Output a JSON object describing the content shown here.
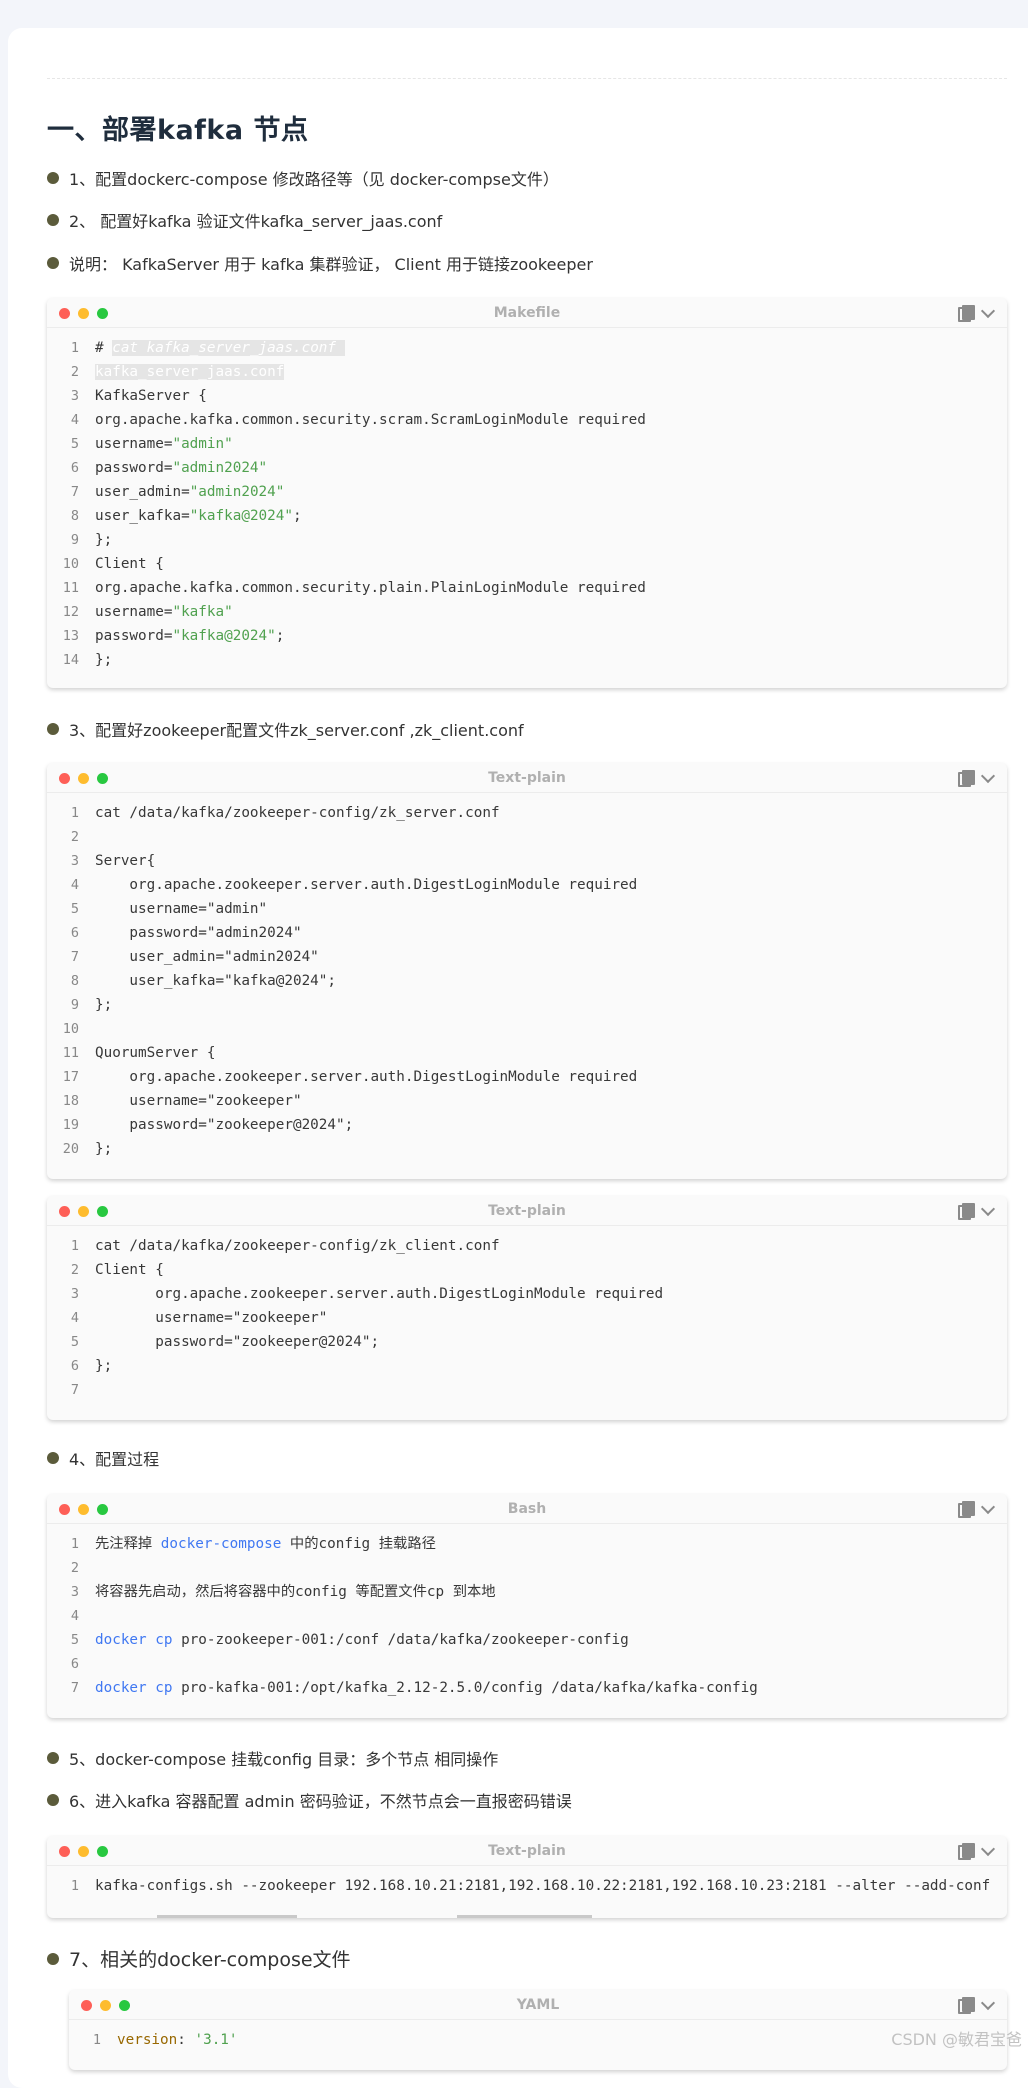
{
  "heading": "一、部署kafka 节点",
  "bullets": [
    "1、配置dockerc-compose 修改路径等（见 docker-compse文件）",
    "2、 配置好kafka 验证文件kafka_server_jaas.conf",
    "说明： KafkaServer 用于 kafka 集群验证， Client 用于链接zookeeper",
    "3、配置好zookeeper配置文件zk_server.conf ,zk_client.conf",
    "4、配置过程",
    "5、docker-compose 挂载config 目录：多个节点 相同操作",
    "6、进入kafka 容器配置 admin 密码验证，不然节点会一直报密码错误",
    "7、相关的docker-compose文件"
  ],
  "code_blocks": [
    {
      "lang": "Makefile",
      "lines": [
        {
          "n": "1",
          "parts": [
            {
              "t": "# ",
              "c": "plain"
            },
            {
              "t": "cat kafka_server_jaas.conf ",
              "c": "hl"
            }
          ]
        },
        {
          "n": "2",
          "parts": [
            {
              "t": "kafka_server_jaas.conf",
              "c": "hlc"
            }
          ]
        },
        {
          "n": "3",
          "parts": [
            {
              "t": "KafkaServer {",
              "c": "plain"
            }
          ]
        },
        {
          "n": "4",
          "parts": [
            {
              "t": "org.apache.kafka.common.security.scram.ScramLoginModule required",
              "c": "plain"
            }
          ]
        },
        {
          "n": "5",
          "parts": [
            {
              "t": "username=",
              "c": "plain"
            },
            {
              "t": "\"admin\"",
              "c": "str"
            }
          ]
        },
        {
          "n": "6",
          "parts": [
            {
              "t": "password=",
              "c": "plain"
            },
            {
              "t": "\"admin2024\"",
              "c": "str"
            }
          ]
        },
        {
          "n": "7",
          "parts": [
            {
              "t": "user_admin=",
              "c": "plain"
            },
            {
              "t": "\"admin2024\"",
              "c": "str"
            }
          ]
        },
        {
          "n": "8",
          "parts": [
            {
              "t": "user_kafka=",
              "c": "plain"
            },
            {
              "t": "\"kafka@2024\"",
              "c": "str"
            },
            {
              "t": ";",
              "c": "plain"
            }
          ]
        },
        {
          "n": "9",
          "parts": [
            {
              "t": "};",
              "c": "plain"
            }
          ]
        },
        {
          "n": "10",
          "parts": [
            {
              "t": "Client {",
              "c": "plain"
            }
          ]
        },
        {
          "n": "11",
          "parts": [
            {
              "t": "org.apache.kafka.common.security.plain.PlainLoginModule required",
              "c": "plain"
            }
          ]
        },
        {
          "n": "12",
          "parts": [
            {
              "t": "username=",
              "c": "plain"
            },
            {
              "t": "\"kafka\"",
              "c": "str"
            }
          ]
        },
        {
          "n": "13",
          "parts": [
            {
              "t": "password=",
              "c": "plain"
            },
            {
              "t": "\"kafka@2024\"",
              "c": "str"
            },
            {
              "t": ";",
              "c": "plain"
            }
          ]
        },
        {
          "n": "14",
          "parts": [
            {
              "t": "};",
              "c": "plain"
            }
          ]
        }
      ]
    },
    {
      "lang": "Text-plain",
      "lines": [
        {
          "n": "1",
          "parts": [
            {
              "t": "cat /data/kafka/zookeeper-config/zk_server.conf",
              "c": "plain"
            }
          ]
        },
        {
          "n": "2",
          "parts": [
            {
              "t": "",
              "c": "plain"
            }
          ]
        },
        {
          "n": "3",
          "parts": [
            {
              "t": "Server{",
              "c": "plain"
            }
          ]
        },
        {
          "n": "4",
          "parts": [
            {
              "t": "    org.apache.zookeeper.server.auth.DigestLoginModule required",
              "c": "plain"
            }
          ]
        },
        {
          "n": "5",
          "parts": [
            {
              "t": "    username=\"admin\"",
              "c": "plain"
            }
          ]
        },
        {
          "n": "6",
          "parts": [
            {
              "t": "    password=\"admin2024\"",
              "c": "plain"
            }
          ]
        },
        {
          "n": "7",
          "parts": [
            {
              "t": "    user_admin=\"admin2024\"",
              "c": "plain"
            }
          ]
        },
        {
          "n": "8",
          "parts": [
            {
              "t": "    user_kafka=\"kafka@2024\";",
              "c": "plain"
            }
          ]
        },
        {
          "n": "9",
          "parts": [
            {
              "t": "};",
              "c": "plain"
            }
          ]
        },
        {
          "n": "10",
          "parts": [
            {
              "t": "",
              "c": "plain"
            }
          ]
        },
        {
          "n": "11",
          "parts": [
            {
              "t": "QuorumServer {",
              "c": "plain"
            }
          ]
        },
        {
          "n": "17",
          "parts": [
            {
              "t": "    org.apache.zookeeper.server.auth.DigestLoginModule required",
              "c": "plain"
            }
          ]
        },
        {
          "n": "18",
          "parts": [
            {
              "t": "    username=\"zookeeper\"",
              "c": "plain"
            }
          ]
        },
        {
          "n": "19",
          "parts": [
            {
              "t": "    password=\"zookeeper@2024\";",
              "c": "plain"
            }
          ]
        },
        {
          "n": "20",
          "parts": [
            {
              "t": "};",
              "c": "plain"
            }
          ]
        }
      ]
    },
    {
      "lang": "Text-plain",
      "lines": [
        {
          "n": "1",
          "parts": [
            {
              "t": "cat /data/kafka/zookeeper-config/zk_client.conf",
              "c": "plain"
            }
          ]
        },
        {
          "n": "2",
          "parts": [
            {
              "t": "Client {",
              "c": "plain"
            }
          ]
        },
        {
          "n": "3",
          "parts": [
            {
              "t": "       org.apache.zookeeper.server.auth.DigestLoginModule required",
              "c": "plain"
            }
          ]
        },
        {
          "n": "4",
          "parts": [
            {
              "t": "       username=\"zookeeper\"",
              "c": "plain"
            }
          ]
        },
        {
          "n": "5",
          "parts": [
            {
              "t": "       password=\"zookeeper@2024\";",
              "c": "plain"
            }
          ]
        },
        {
          "n": "6",
          "parts": [
            {
              "t": "};",
              "c": "plain"
            }
          ]
        },
        {
          "n": "7",
          "parts": [
            {
              "t": "",
              "c": "plain"
            }
          ]
        }
      ]
    },
    {
      "lang": "Bash",
      "lines": [
        {
          "n": "1",
          "parts": [
            {
              "t": "先注释掉 ",
              "c": "plain"
            },
            {
              "t": "docker-compose",
              "c": "kw"
            },
            {
              "t": " 中的config 挂载路径",
              "c": "plain"
            }
          ]
        },
        {
          "n": "2",
          "parts": [
            {
              "t": "",
              "c": "plain"
            }
          ]
        },
        {
          "n": "3",
          "parts": [
            {
              "t": "将容器先启动，然后将容器中的config 等配置文件cp 到本地",
              "c": "plain"
            }
          ]
        },
        {
          "n": "4",
          "parts": [
            {
              "t": "",
              "c": "plain"
            }
          ]
        },
        {
          "n": "5",
          "parts": [
            {
              "t": "docker",
              "c": "kw"
            },
            {
              "t": " ",
              "c": "plain"
            },
            {
              "t": "cp",
              "c": "kw"
            },
            {
              "t": " pro-zookeeper-001:/conf /data/kafka/zookeeper-config",
              "c": "plain"
            }
          ]
        },
        {
          "n": "6",
          "parts": [
            {
              "t": "",
              "c": "plain"
            }
          ]
        },
        {
          "n": "7",
          "parts": [
            {
              "t": "docker",
              "c": "kw"
            },
            {
              "t": " ",
              "c": "plain"
            },
            {
              "t": "cp",
              "c": "kw"
            },
            {
              "t": " pro-kafka-001:/opt/kafka_2.12-2.5.0/config /data/kafka/kafka-config",
              "c": "plain"
            }
          ]
        }
      ]
    },
    {
      "lang": "Text-plain",
      "lines": [
        {
          "n": "1",
          "parts": [
            {
              "t": "kafka-configs.sh --zookeeper 192.168.10.21:2181,192.168.10.22:2181,192.168.10.23:2181 --alter --add-conf",
              "c": "plain"
            }
          ]
        }
      ]
    },
    {
      "lang": "YAML",
      "lines": [
        {
          "n": "1",
          "parts": [
            {
              "t": "version",
              "c": "yk"
            },
            {
              "t": ": ",
              "c": "plain"
            },
            {
              "t": "'3.1'",
              "c": "str"
            }
          ]
        }
      ]
    }
  ],
  "watermark": "CSDN @敏君宝爸",
  "colors": {
    "string": "#50a14f",
    "keyword": "#4078f2",
    "yaml_key": "#986801",
    "bullet_dot": "#5b5b3b"
  }
}
